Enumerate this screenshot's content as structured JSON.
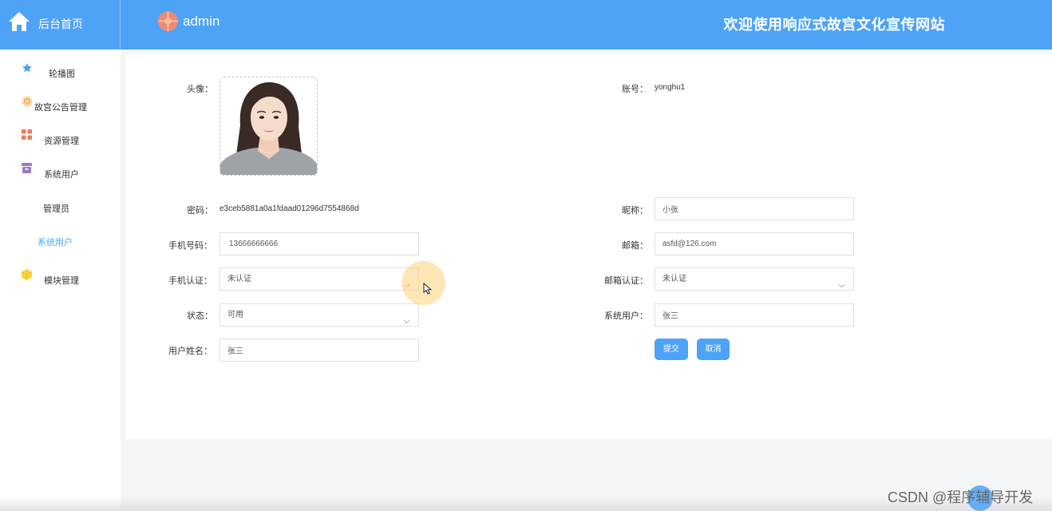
{
  "header": {
    "home_label": "后台首页",
    "admin_name": "admin",
    "site_title": "欢迎使用响应式故宫文化宣传网站"
  },
  "sidebar": {
    "items": [
      {
        "label": "轮播图",
        "icon": "star-icon",
        "color": "#4da3f7"
      },
      {
        "label": "故宫公告管理",
        "icon": "gear-icon",
        "color": "#f5b25a"
      },
      {
        "label": "资源管理",
        "icon": "grid-icon",
        "color": "#f0785a"
      },
      {
        "label": "系统用户",
        "icon": "archive-icon",
        "color": "#9a7bc7"
      },
      {
        "label": "管理员",
        "icon": "",
        "color": ""
      },
      {
        "label": "系统用户",
        "icon": "",
        "color": "#4da3f7"
      },
      {
        "label": "模块管理",
        "icon": "cube-icon",
        "color": "#f7d43b"
      }
    ],
    "active_index": 5
  },
  "form": {
    "avatar_label": "头像：",
    "account_label": "账号：",
    "account_value": "yonghu1",
    "password_label": "密码：",
    "password_value": "e3ceb5881a0a1fdaad01296d7554868d",
    "nickname_label": "昵称：",
    "nickname_value": "小张",
    "phone_label": "手机号码：",
    "phone_value": "13666666666",
    "email_label": "邮箱：",
    "email_value": "asfd@126.com",
    "phone_verify_label": "手机认证：",
    "phone_verify_value": "未认证",
    "email_verify_label": "邮箱认证：",
    "email_verify_value": "未认证",
    "status_label": "状态：",
    "status_value": "可用",
    "sys_user_label": "系统用户：",
    "sys_user_value": "张三",
    "username_label": "用户姓名：",
    "username_value": "张三",
    "submit_label": "提交",
    "cancel_label": "取消"
  },
  "watermark": "CSDN @程序辅导开发",
  "colors": {
    "accent": "#4da3f7",
    "topbar": "#4da3f7",
    "page_bg": "#f4f5f7"
  }
}
